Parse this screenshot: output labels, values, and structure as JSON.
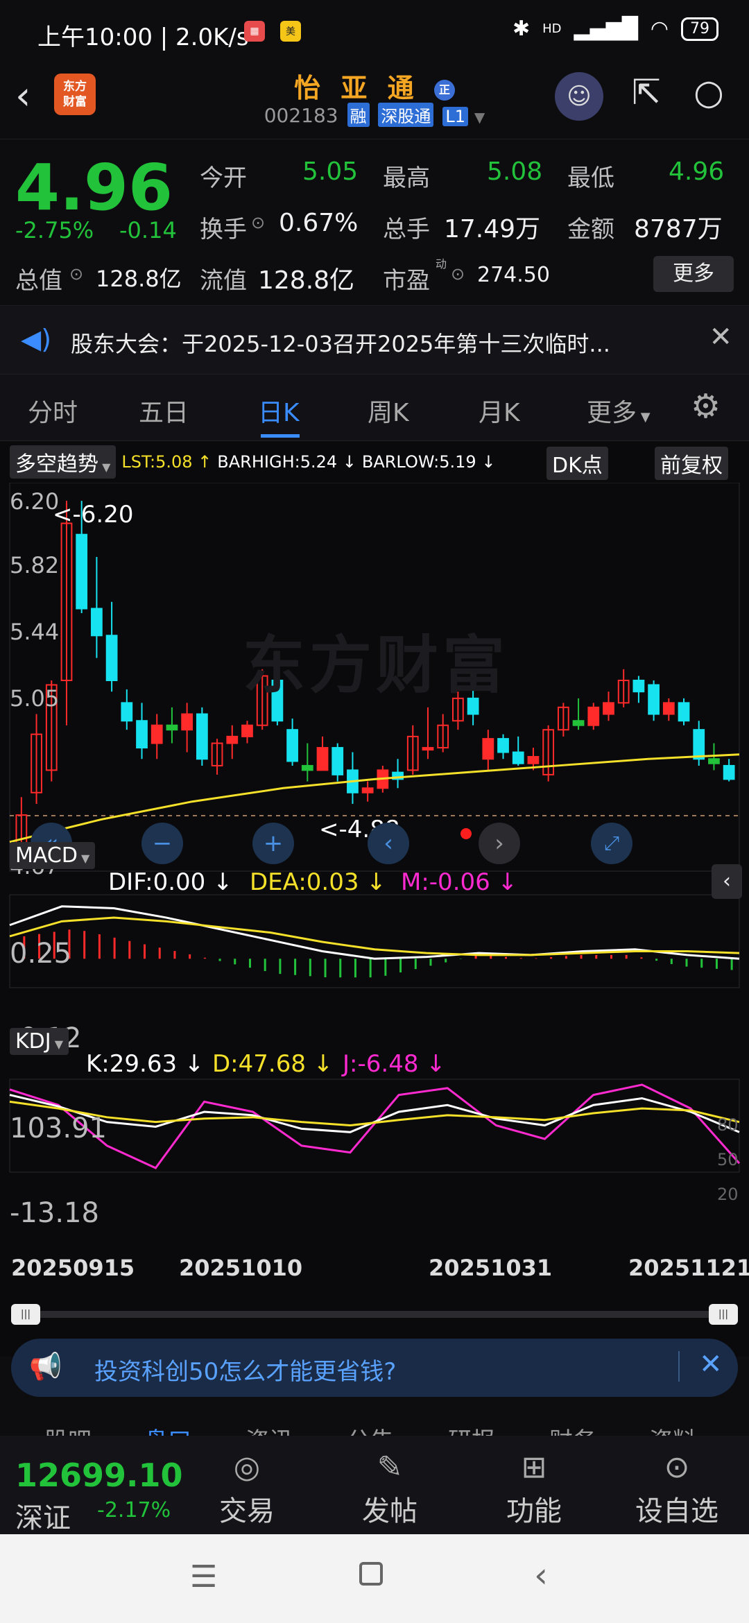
{
  "status_bar": {
    "time": "上午10:00 | 2.0K/s",
    "battery": "79",
    "signal": "HD"
  },
  "header": {
    "name": "怡 亚 通",
    "name_badge": "正",
    "code": "002183",
    "tags": [
      "融",
      "深股通",
      "L1"
    ]
  },
  "logo": {
    "line1": "东方",
    "line2": "财富"
  },
  "quote": {
    "price": "4.96",
    "change_pct": "-2.75%",
    "change": "-0.14",
    "open_label": "今开",
    "open": "5.05",
    "high_label": "最高",
    "high": "5.08",
    "low_label": "最低",
    "low": "4.96",
    "turnover_label": "换手",
    "turnover": "0.67%",
    "volume_label": "总手",
    "volume": "17.49万",
    "amount_label": "金额",
    "amount": "8787万",
    "mcap_label": "总值",
    "mcap": "128.8亿",
    "float_label": "流值",
    "float": "128.8亿",
    "pe_label": "市盈",
    "pe_sup": "动",
    "pe": "274.50",
    "more": "更多"
  },
  "notice": {
    "text": "股东大会：于2025-12-03召开2025年第十三次临时..."
  },
  "tabs": [
    "分时",
    "五日",
    "日K",
    "周K",
    "月K",
    "更多"
  ],
  "chart_toolbar": {
    "indicator": "多空趋势",
    "lst": "LST:5.08 ↑",
    "barhigh": "BARHIGH:5.24 ↓",
    "barlow": "BARLOW:5.19 ↓",
    "dk": "DK点",
    "adjust": "前复权"
  },
  "main_chart": {
    "y_labels": [
      "6.20",
      "5.82",
      "5.44",
      "5.05",
      "4.67"
    ],
    "high_mark": "<-6.20",
    "low_mark": "<-4.88",
    "watermark": "东方财富"
  },
  "macd": {
    "name": "MACD",
    "dif": "DIF:0.00 ↓",
    "dea": "DEA:0.03 ↓",
    "m": "M:-0.06 ↓",
    "y_top": "0.25",
    "y_bottom": "-0.12"
  },
  "kdj": {
    "name": "KDJ",
    "k": "K:29.63 ↓",
    "d": "D:47.68 ↓",
    "j": "J:-6.48 ↓",
    "y_top": "103.91",
    "y_bottom": "-13.18",
    "levels": [
      "80",
      "50",
      "20"
    ]
  },
  "dates": [
    "20250915",
    "20251010",
    "20251031",
    "20251121"
  ],
  "promo": {
    "text": "投资科创50怎么才能更省钱?"
  },
  "sub_tabs": [
    "股吧",
    "盘口",
    "资讯",
    "公告",
    "研报",
    "财务",
    "资料"
  ],
  "bottom": {
    "index_value": "12699.10",
    "index_name": "深证",
    "index_change": "-2.17%",
    "buttons": [
      {
        "label": "交易",
        "icon": "yen-icon"
      },
      {
        "label": "发帖",
        "icon": "edit-icon"
      },
      {
        "label": "功能",
        "icon": "grid-icon"
      },
      {
        "label": "设自选",
        "icon": "more-icon"
      }
    ]
  },
  "colors": {
    "up": "#ff2a2a",
    "down": "#22c23b",
    "accent": "#3a8cff",
    "brand": "#e25722",
    "yellow": "#f5e02a"
  },
  "chart_data": {
    "type": "candlestick",
    "dates": [
      "20250915",
      "20251010",
      "20251031",
      "20251121"
    ],
    "ohlc": [
      [
        4.62,
        4.88,
        4.62,
        4.8
      ],
      [
        4.9,
        5.25,
        4.85,
        5.16
      ],
      [
        5.0,
        5.4,
        4.95,
        5.38
      ],
      [
        5.4,
        6.2,
        5.2,
        6.1
      ],
      [
        6.05,
        6.2,
        5.7,
        5.72
      ],
      [
        5.72,
        5.95,
        5.5,
        5.6
      ],
      [
        5.6,
        5.75,
        5.35,
        5.4
      ],
      [
        5.3,
        5.36,
        5.18,
        5.22
      ],
      [
        5.22,
        5.3,
        5.05,
        5.1
      ],
      [
        5.12,
        5.25,
        5.05,
        5.2
      ],
      [
        5.2,
        5.28,
        5.12,
        5.18
      ],
      [
        5.18,
        5.3,
        5.08,
        5.25
      ],
      [
        5.25,
        5.28,
        5.02,
        5.05
      ],
      [
        5.02,
        5.14,
        4.98,
        5.12
      ],
      [
        5.12,
        5.2,
        5.05,
        5.15
      ],
      [
        5.15,
        5.22,
        5.12,
        5.2
      ],
      [
        5.2,
        5.45,
        5.18,
        5.42
      ],
      [
        5.4,
        5.46,
        5.2,
        5.22
      ],
      [
        5.18,
        5.23,
        5.02,
        5.04
      ],
      [
        5.02,
        5.12,
        4.95,
        5.0
      ],
      [
        5.0,
        5.15,
        5.0,
        5.1
      ],
      [
        5.1,
        5.12,
        4.95,
        4.98
      ],
      [
        5.0,
        5.08,
        4.85,
        4.9
      ],
      [
        4.9,
        4.95,
        4.86,
        4.92
      ],
      [
        4.92,
        5.02,
        4.9,
        5.0
      ],
      [
        4.99,
        5.05,
        4.92,
        4.96
      ],
      [
        5.0,
        5.2,
        4.98,
        5.15
      ],
      [
        5.1,
        5.28,
        5.05,
        5.1
      ],
      [
        5.1,
        5.25,
        5.08,
        5.2
      ],
      [
        5.22,
        5.35,
        5.18,
        5.32
      ],
      [
        5.32,
        5.38,
        5.2,
        5.25
      ],
      [
        5.05,
        5.18,
        5.0,
        5.14
      ],
      [
        5.14,
        5.16,
        5.05,
        5.08
      ],
      [
        5.08,
        5.15,
        5.02,
        5.03
      ],
      [
        5.03,
        5.1,
        5.0,
        5.06
      ],
      [
        4.98,
        5.2,
        4.95,
        5.18
      ],
      [
        5.18,
        5.3,
        5.15,
        5.28
      ],
      [
        5.22,
        5.32,
        5.18,
        5.2
      ],
      [
        5.2,
        5.3,
        5.18,
        5.28
      ],
      [
        5.25,
        5.35,
        5.22,
        5.3
      ],
      [
        5.3,
        5.45,
        5.28,
        5.4
      ],
      [
        5.4,
        5.42,
        5.3,
        5.35
      ],
      [
        5.38,
        5.4,
        5.22,
        5.25
      ],
      [
        5.25,
        5.32,
        5.22,
        5.3
      ],
      [
        5.3,
        5.32,
        5.2,
        5.22
      ],
      [
        5.18,
        5.22,
        5.02,
        5.05
      ],
      [
        5.05,
        5.12,
        5.0,
        5.03
      ],
      [
        5.02,
        5.05,
        4.95,
        4.96
      ]
    ],
    "ma_line": [
      4.68,
      4.78,
      4.86,
      4.92,
      4.96,
      4.99,
      5.02,
      5.05,
      5.07
    ],
    "macd_dif": [
      0.18,
      0.28,
      0.27,
      0.22,
      0.16,
      0.1,
      0.04,
      0.0,
      0.01,
      0.03,
      0.02,
      0.04,
      0.05,
      0.02,
      0.0
    ],
    "macd_dea": [
      0.12,
      0.2,
      0.22,
      0.2,
      0.17,
      0.14,
      0.09,
      0.05,
      0.03,
      0.02,
      0.02,
      0.03,
      0.04,
      0.04,
      0.03
    ],
    "kdj_k": [
      95,
      78,
      55,
      48,
      70,
      65,
      45,
      40,
      70,
      80,
      60,
      50,
      80,
      90,
      70,
      40
    ],
    "kdj_d": [
      85,
      75,
      62,
      55,
      60,
      62,
      55,
      50,
      58,
      65,
      62,
      58,
      68,
      75,
      72,
      55
    ],
    "kdj_j": [
      103,
      80,
      20,
      -13,
      85,
      70,
      20,
      10,
      95,
      105,
      50,
      30,
      95,
      110,
      75,
      -6
    ]
  }
}
